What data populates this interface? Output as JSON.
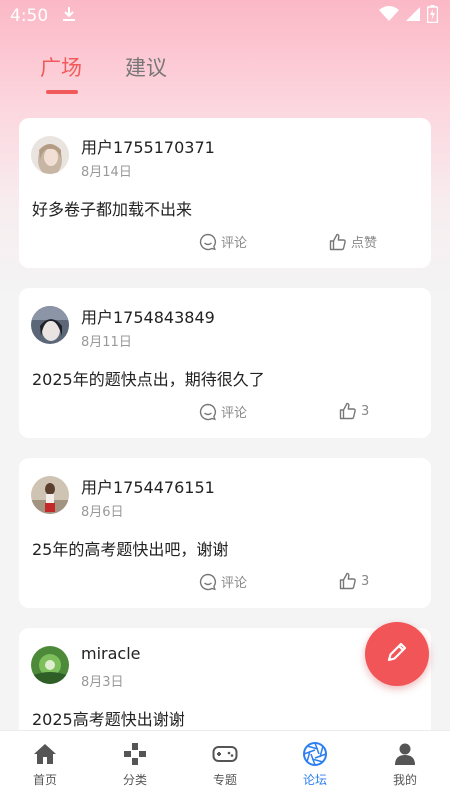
{
  "status_bar": {
    "time": "4:50",
    "icons": [
      "download-icon",
      "wifi-icon",
      "signal-icon",
      "battery-charging-icon"
    ]
  },
  "tabs": [
    {
      "label": "广场",
      "active": true
    },
    {
      "label": "建议",
      "active": false
    }
  ],
  "posts": [
    {
      "username": "用户1755170371",
      "date": "8月14日",
      "content": "好多卷子都加载不出来",
      "comment_label": "评论",
      "like_label": "点赞"
    },
    {
      "username": "用户1754843849",
      "date": "8月11日",
      "content": "2025年的题快点出，期待很久了",
      "comment_label": "评论",
      "like_label": "3"
    },
    {
      "username": "用户1754476151",
      "date": "8月6日",
      "content": "25年的高考题快出吧，谢谢",
      "comment_label": "评论",
      "like_label": "3"
    },
    {
      "username": "miracle",
      "date": "8月3日",
      "content": "2025高考题快出谢谢"
    }
  ],
  "fab": {
    "icon": "pencil-icon"
  },
  "bottom_nav": [
    {
      "label": "首页",
      "icon": "home-icon",
      "active": false
    },
    {
      "label": "分类",
      "icon": "gamepad-cross-icon",
      "active": false
    },
    {
      "label": "专题",
      "icon": "gamepad-icon",
      "active": false
    },
    {
      "label": "论坛",
      "icon": "camera-aperture-icon",
      "active": true
    },
    {
      "label": "我的",
      "icon": "person-icon",
      "active": false
    }
  ],
  "colors": {
    "accent": "#f15a5a",
    "nav_active": "#2d7ff0",
    "fab": "#f25557"
  }
}
